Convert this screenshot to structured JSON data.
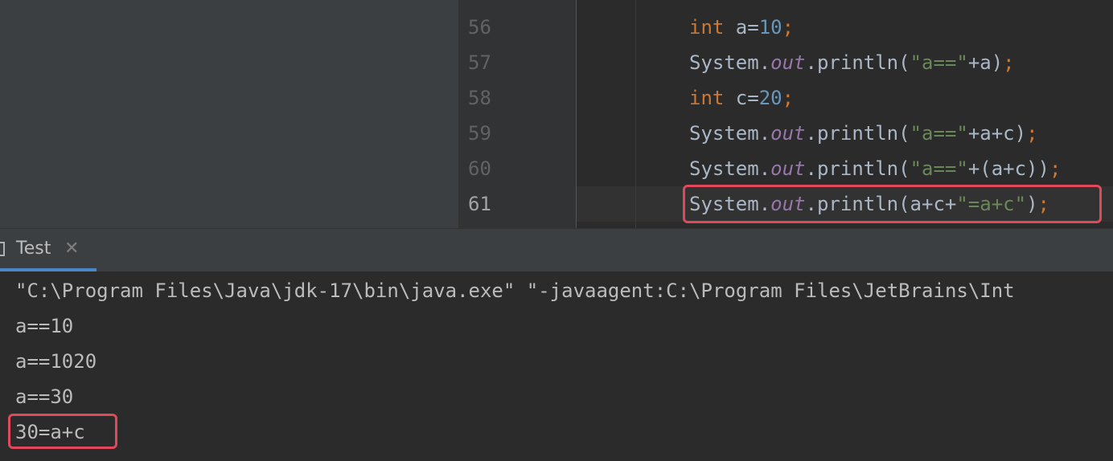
{
  "editor": {
    "line_numbers": [
      "56",
      "57",
      "58",
      "59",
      "60",
      "61"
    ],
    "lines": [
      [
        {
          "t": "int",
          "c": "kw"
        },
        {
          "t": " a=",
          "c": ""
        },
        {
          "t": "10",
          "c": "num"
        },
        {
          "t": ";",
          "c": "semi"
        }
      ],
      [
        {
          "t": "System.",
          "c": ""
        },
        {
          "t": "out",
          "c": "fld"
        },
        {
          "t": ".println(",
          "c": ""
        },
        {
          "t": "\"a==\"",
          "c": "str"
        },
        {
          "t": "+a)",
          "c": ""
        },
        {
          "t": ";",
          "c": "semi"
        }
      ],
      [
        {
          "t": "int",
          "c": "kw"
        },
        {
          "t": " c=",
          "c": ""
        },
        {
          "t": "20",
          "c": "num"
        },
        {
          "t": ";",
          "c": "semi"
        }
      ],
      [
        {
          "t": "System.",
          "c": ""
        },
        {
          "t": "out",
          "c": "fld"
        },
        {
          "t": ".println(",
          "c": ""
        },
        {
          "t": "\"a==\"",
          "c": "str"
        },
        {
          "t": "+a+c)",
          "c": ""
        },
        {
          "t": ";",
          "c": "semi"
        }
      ],
      [
        {
          "t": "System.",
          "c": ""
        },
        {
          "t": "out",
          "c": "fld"
        },
        {
          "t": ".println(",
          "c": ""
        },
        {
          "t": "\"a==\"",
          "c": "str"
        },
        {
          "t": "+(a+c))",
          "c": ""
        },
        {
          "t": ";",
          "c": "semi"
        }
      ],
      [
        {
          "t": "System.",
          "c": ""
        },
        {
          "t": "out",
          "c": "fld"
        },
        {
          "t": ".println(a+c+",
          "c": ""
        },
        {
          "t": "\"=a+c\"",
          "c": "str"
        },
        {
          "t": ")",
          "c": ""
        },
        {
          "t": ";",
          "c": "semi"
        }
      ]
    ]
  },
  "run_panel": {
    "tab_label": "Test",
    "close_glyph": "✕",
    "console": [
      "\"C:\\Program Files\\Java\\jdk-17\\bin\\java.exe\" \"-javaagent:C:\\Program Files\\JetBrains\\Int",
      "a==10",
      "a==1020",
      "a==30",
      "30=a+c"
    ]
  },
  "colors": {
    "keyword": "#cc7832",
    "number": "#6897bb",
    "string": "#6a8759",
    "field": "#9876aa",
    "highlight_border": "#e0485b",
    "tab_underline": "#4a88c7"
  },
  "icons": {
    "run_tab": "console-icon",
    "close": "close-icon"
  }
}
